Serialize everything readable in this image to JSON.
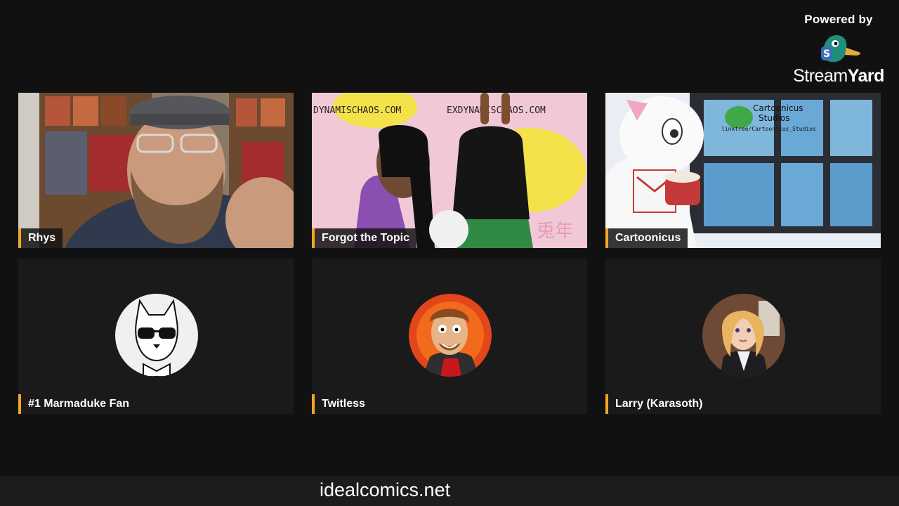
{
  "branding": {
    "powered_by": "Powered by",
    "brand_light": "Stream",
    "brand_bold": "Yard",
    "logo_icon": "streamyard-duck-icon"
  },
  "participants": [
    {
      "name": "Rhys",
      "media": "camera"
    },
    {
      "name": "Forgot the Topic",
      "media": "camera",
      "overlay_text": [
        "DYNAMISCHAOS.COM",
        "EXDYNAMISCHAOS.COM"
      ]
    },
    {
      "name": "Cartoonicus",
      "media": "camera",
      "overlay_text": [
        "Cartoonicus",
        "Studios",
        "linktree/Cartoonicus_Studios"
      ]
    },
    {
      "name": "#1 Marmaduke Fan",
      "media": "avatar"
    },
    {
      "name": "Twitless",
      "media": "avatar"
    },
    {
      "name": "Larry (Karasoth)",
      "media": "avatar"
    }
  ],
  "ticker": {
    "text": "idealcomics.net"
  },
  "colors": {
    "background": "#111111",
    "accent": "#f5a623",
    "ticker_bg": "#1c1c1c"
  }
}
